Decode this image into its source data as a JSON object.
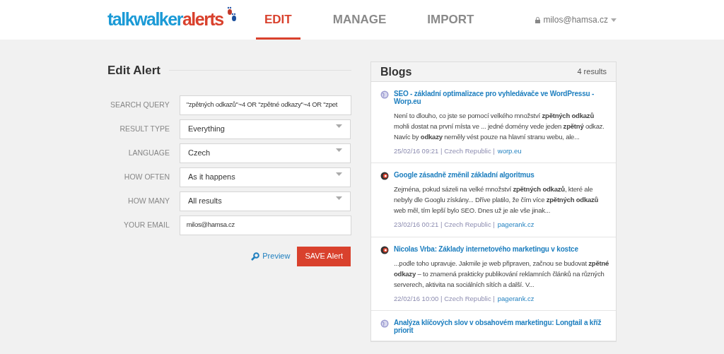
{
  "header": {
    "logo": {
      "part_1": "talkwalker",
      "part_2": "alerts"
    },
    "tabs": [
      {
        "label": "EDIT",
        "selected": true
      },
      {
        "label": "MANAGE",
        "selected": false
      },
      {
        "label": "IMPORT",
        "selected": false
      }
    ],
    "account": "milos@hamsa.cz"
  },
  "form": {
    "title": "Edit Alert",
    "fields": [
      {
        "label": "SEARCH QUERY",
        "kind": "text",
        "value": "\"zpětných odkazů\"~4 OR \"zpětné odkazy\"~4 OR \"zpet"
      },
      {
        "label": "RESULT TYPE",
        "kind": "select",
        "value": "Everything"
      },
      {
        "label": "LANGUAGE",
        "kind": "select",
        "value": "Czech"
      },
      {
        "label": "HOW OFTEN",
        "kind": "select",
        "value": "As it happens"
      },
      {
        "label": "HOW MANY",
        "kind": "select",
        "value": "All results"
      },
      {
        "label": "YOUR EMAIL",
        "kind": "text",
        "value": "milos@hamsa.cz"
      }
    ],
    "preview": "Preview",
    "save": "SAVE Alert"
  },
  "results": {
    "title": "Blogs",
    "count": "4 results",
    "items": [
      {
        "kind": "globe",
        "title": "SEO - základní optimalizace pro vyhledávače ve WordPressu - Worp.eu",
        "snippet": "Není to dlouho, co jste se pomocí velkého množství **zpětných odkazů** mohli dostat na první místa ve ... jedné domény vede jeden **zpětný** odkaz. Navíc by **odkazy** neměly vést pouze na hlavní stranu webu, ale...",
        "meta": "25/02/16 09:21 | Czech Republic |",
        "source": "worp.eu"
      },
      {
        "kind": "pagerank",
        "title": "Google zásadně změnil základní algoritmus",
        "snippet": "Zejména, pokud sázeli na velké množství **zpětných odkazů**, které ale nebyly dle Googlu získány... Dříve platilo, že čím více **zpětných odkazů** web měl, tím lepší bylo SEO. Dnes už je ale vše jinak...",
        "meta": "23/02/16 00:21 | Czech Republic |",
        "source": "pagerank.cz"
      },
      {
        "kind": "pagerank",
        "title": "Nicolas Vrba: Základy internetového marketingu v kostce",
        "snippet": "...podle toho upravuje. Jakmile je web připraven, začnou se budovat **zpětné odkazy** – to znamená prakticky publikování reklamních článků na různých serverech, aktivita na sociálních sítích a další. V...",
        "meta": "22/02/16 10:00 | Czech Republic |",
        "source": "pagerank.cz"
      },
      {
        "kind": "globe",
        "title": "Analýza klíčových slov v obsahovém marketingu: Longtail a kříž priorit"
      }
    ]
  }
}
